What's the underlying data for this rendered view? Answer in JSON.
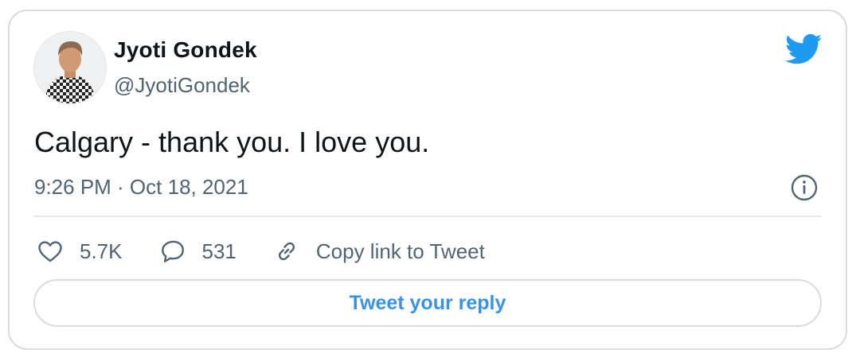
{
  "author": {
    "name": "Jyoti Gondek",
    "handle": "@JyotiGondek"
  },
  "tweet": {
    "text": "Calgary - thank you. I love you.",
    "timestamp": "9:26 PM · Oct 18, 2021"
  },
  "actions": {
    "likes": "5.7K",
    "replies": "531",
    "copy_link": "Copy link to Tweet"
  },
  "reply_button": "Tweet your reply",
  "icons": {
    "logo": "twitter-bird-icon",
    "info": "info-icon",
    "like": "heart-icon",
    "reply": "reply-bubble-icon",
    "copy": "link-icon"
  },
  "colors": {
    "brand": "#1d9bf0",
    "reply_text": "#3a92e6",
    "secondary_text": "#536471",
    "border": "#d7dce0"
  }
}
